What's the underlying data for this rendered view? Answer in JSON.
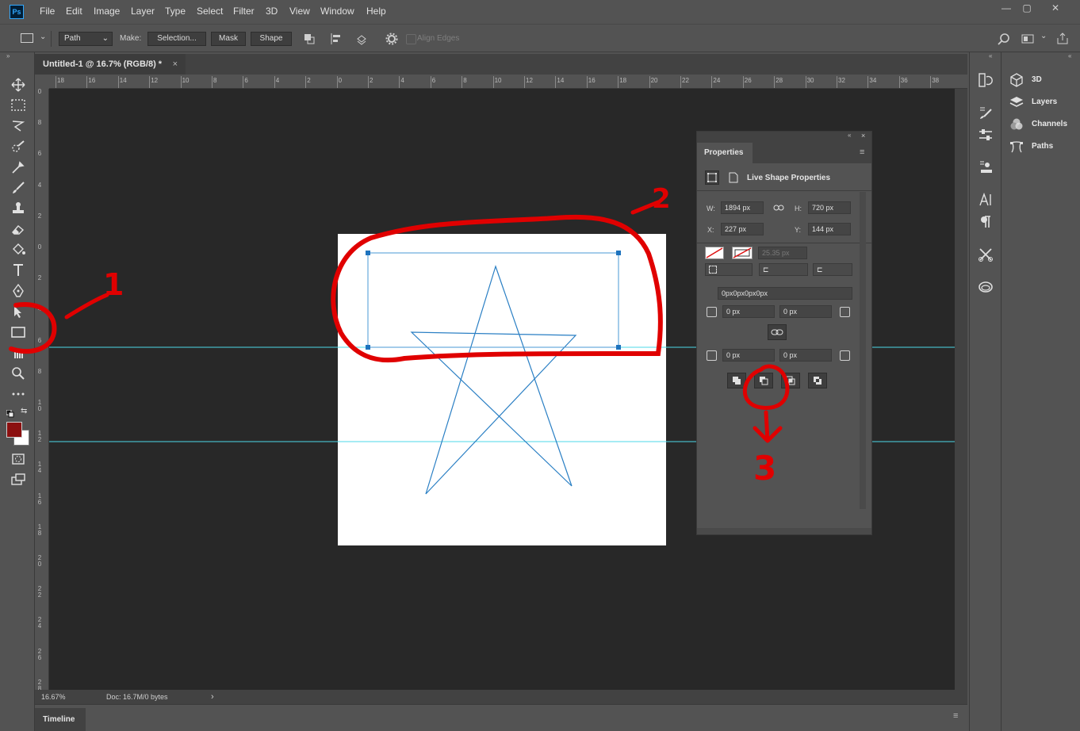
{
  "menu": {
    "items": [
      "File",
      "Edit",
      "Image",
      "Layer",
      "Type",
      "Select",
      "Filter",
      "3D",
      "View",
      "Window",
      "Help"
    ],
    "window_controls": [
      "—",
      "▢",
      "✕"
    ]
  },
  "options_bar": {
    "mode_value": "Path",
    "make_label": "Make:",
    "selection_label": "Selection...",
    "mask_label": "Mask",
    "shape_label": "Shape",
    "align_edges_label": "Align Edges"
  },
  "document": {
    "tab_title": "Untitled-1 @ 16.7% (RGB/8) *",
    "tab_close": "×"
  },
  "ruler": {
    "h_ticks": [
      "18",
      "16",
      "14",
      "12",
      "10",
      "8",
      "6",
      "4",
      "2",
      "0",
      "2",
      "4",
      "6",
      "8",
      "10",
      "12",
      "14",
      "16",
      "18",
      "20",
      "22",
      "24",
      "26",
      "28",
      "30",
      "32",
      "34",
      "36",
      "38"
    ],
    "v_ticks": [
      "0",
      "8",
      "6",
      "4",
      "2",
      "0",
      "2",
      "4",
      "6",
      "8",
      "1 0",
      "1 2",
      "1 4",
      "1 6",
      "1 8",
      "2 0",
      "2 2",
      "2 4",
      "2 6",
      "2 8"
    ]
  },
  "status": {
    "zoom": "16.67%",
    "doc_info": "Doc: 16.7M/0 bytes",
    "arrow": "›"
  },
  "timeline": {
    "label": "Timeline"
  },
  "right_panels": {
    "items": [
      "3D",
      "Layers",
      "Channels",
      "Paths"
    ]
  },
  "properties": {
    "tab_label": "Properties",
    "section_title": "Live Shape Properties",
    "w_label": "W:",
    "w_value": "1894 px",
    "h_label": "H:",
    "h_value": "720 px",
    "x_label": "X:",
    "x_value": "227 px",
    "y_label": "Y:",
    "y_value": "144 px",
    "stroke_width": "25.35 px",
    "corner_field": "0px0px0px0px",
    "corner_tl": "0 px",
    "corner_tr": "0 px",
    "corner_bl": "0 px",
    "corner_br": "0 px"
  },
  "annotations": {
    "label_1": "1",
    "label_2": "2",
    "label_3": "3"
  },
  "colors": {
    "foreground": "#8b1010",
    "background": "#ffffff",
    "selection": "#1e73be",
    "guide": "#4dd8e8",
    "annotation": "#e00000"
  }
}
